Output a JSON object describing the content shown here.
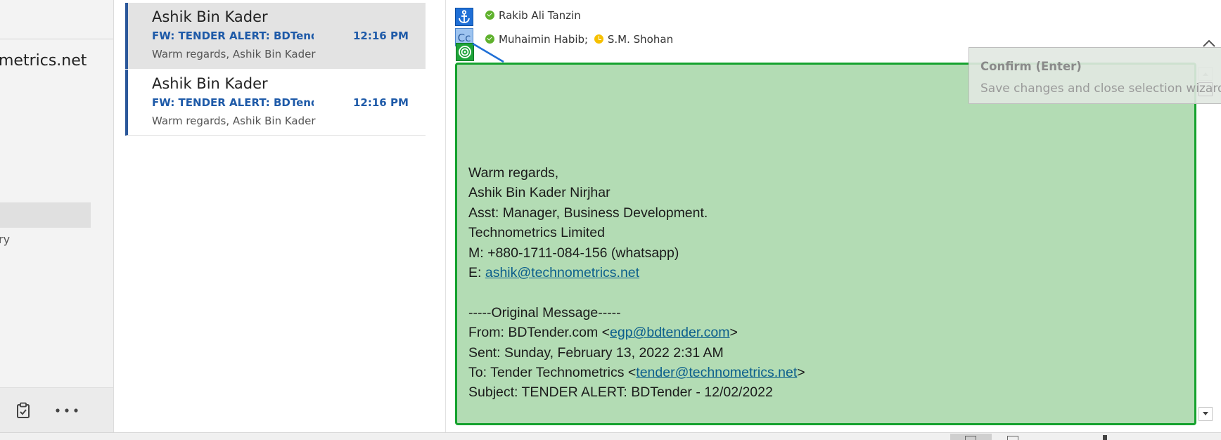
{
  "folder_pane": {
    "account_label": "metrics.net",
    "folder_history_label": "ry"
  },
  "message_list": {
    "items": [
      {
        "sender": "Ashik Bin Kader",
        "subject": "FW: TENDER ALERT: BDTend...",
        "time": "12:16 PM",
        "preview": "Warm regards,  Ashik Bin Kader",
        "selected": true
      },
      {
        "sender": "Ashik Bin Kader",
        "subject": "FW: TENDER ALERT: BDTend...",
        "time": "12:16 PM",
        "preview": "Warm regards,  Ashik Bin Kader",
        "selected": false
      }
    ]
  },
  "reading_pane": {
    "to_line": {
      "recipient_1": "Rakib Ali Tanzin",
      "recipient_1_status": "available"
    },
    "cc_line": {
      "recipient_1": "Muhaimin Habib;",
      "recipient_1_status": "available",
      "recipient_2": "S.M. Shohan",
      "recipient_2_status": "away"
    },
    "cc_badge_label": "Cc",
    "body": {
      "signoff": "Warm regards,",
      "name": "Ashik Bin Kader Nirjhar",
      "title": "Asst: Manager, Business Development.",
      "company": "Technometrics Limited",
      "mobile": "M: +880-1711-084-156 (whatsapp)",
      "email_prefix": "E: ",
      "email_link": "ashik@technometrics.net",
      "original_header": "-----Original Message-----",
      "from_prefix": "From: BDTender.com <",
      "from_link": "egp@bdtender.com",
      "from_suffix": ">",
      "sent": "Sent: Sunday, February 13, 2022 2:31 AM",
      "to_prefix": "To: Tender Technometrics <",
      "to_link": "tender@technometrics.net",
      "to_suffix": ">",
      "subject": "Subject: TENDER ALERT: BDTender - 12/02/2022"
    }
  },
  "overlay": {
    "confirm_title": "Confirm (Enter)",
    "confirm_description": "Save changes and close selection wizard.",
    "selection_fill": "#b3dcb4",
    "selection_border": "#15a22e"
  },
  "colors": {
    "accent_blue": "#1e5aa8",
    "link": "#0b5e8c",
    "presence_available": "#5fb12d",
    "presence_away": "#f6c000"
  },
  "icons": {
    "anchor_badge": "anchor-icon",
    "target_badge": "target-icon",
    "tasks": "clipboard-check-icon",
    "more": "more-horizontal-icon"
  }
}
